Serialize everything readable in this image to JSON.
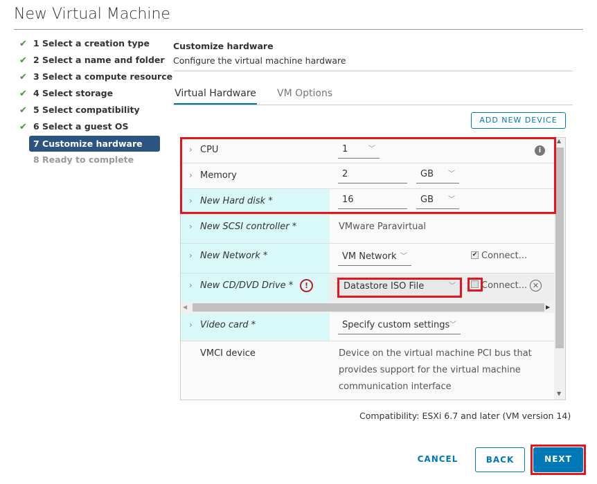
{
  "title": "New Virtual Machine",
  "steps": [
    {
      "label": "1 Select a creation type",
      "done": true
    },
    {
      "label": "2 Select a name and folder",
      "done": true
    },
    {
      "label": "3 Select a compute resource",
      "done": true
    },
    {
      "label": "4 Select storage",
      "done": true
    },
    {
      "label": "5 Select compatibility",
      "done": true
    },
    {
      "label": "6 Select a guest OS",
      "done": true
    },
    {
      "label": "7 Customize hardware",
      "active": true
    },
    {
      "label": "8 Ready to complete"
    }
  ],
  "section": {
    "title": "Customize hardware",
    "subtitle": "Configure the virtual machine hardware"
  },
  "tabs": [
    "Virtual Hardware",
    "VM Options"
  ],
  "add_device": "ADD NEW DEVICE",
  "hardware": {
    "cpu": {
      "label": "CPU",
      "value": "1"
    },
    "memory": {
      "label": "Memory",
      "value": "2",
      "unit": "GB"
    },
    "disk": {
      "label": "New Hard disk *",
      "value": "16",
      "unit": "GB"
    },
    "scsi": {
      "label": "New SCSI controller *",
      "value": "VMware Paravirtual"
    },
    "network": {
      "label": "New Network *",
      "value": "VM Network",
      "connect": "Connect...",
      "connected": true
    },
    "cd": {
      "label": "New CD/DVD Drive *",
      "value": "Datastore ISO File",
      "connect": "Connect...",
      "connected": false
    },
    "video": {
      "label": "Video card *",
      "value": "Specify custom settings"
    },
    "vmci": {
      "label": "VMCI device",
      "desc1": "Device on the virtual machine PCI bus that",
      "desc2": "provides support for the virtual machine",
      "desc3": "communication interface"
    }
  },
  "compatibility": "Compatibility: ESXi 6.7 and later (VM version 14)",
  "buttons": {
    "cancel": "CANCEL",
    "back": "BACK",
    "next": "NEXT"
  },
  "colors": {
    "accent": "#0079b8",
    "active_step": "#2c5480",
    "highlight": "#e4151f",
    "check": "#3c9a2e"
  }
}
